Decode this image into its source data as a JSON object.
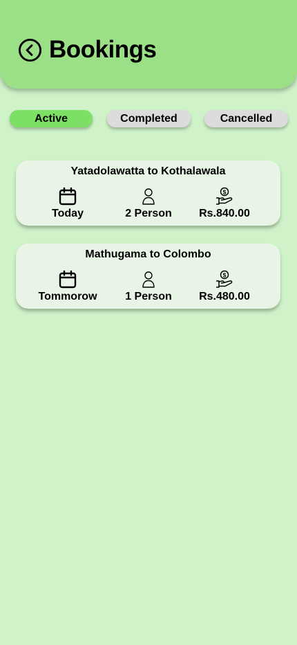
{
  "header": {
    "title": "Bookings",
    "back_icon": "chevron-left-circle-icon",
    "background_color": "#9be087"
  },
  "tabs": [
    {
      "label": "Active",
      "selected": true,
      "color": "#7de066"
    },
    {
      "label": "Completed",
      "selected": false,
      "color": "#dcdcdc"
    },
    {
      "label": "Cancelled",
      "selected": false,
      "color": "#dcdcdc"
    }
  ],
  "bookings": [
    {
      "route": "Yatadolawatta to Kothalawala",
      "date": "Today",
      "persons": "2 Person",
      "price": "Rs.840.00"
    },
    {
      "route": "Mathugama to Colombo",
      "date": "Tommorow",
      "persons": "1 Person",
      "price": "Rs.480.00"
    }
  ],
  "icons": {
    "date": "calendar-icon",
    "persons": "person-icon",
    "price": "money-hand-icon"
  },
  "colors": {
    "page_background": "#cff2c8",
    "card_background": "#e8f5e6"
  }
}
